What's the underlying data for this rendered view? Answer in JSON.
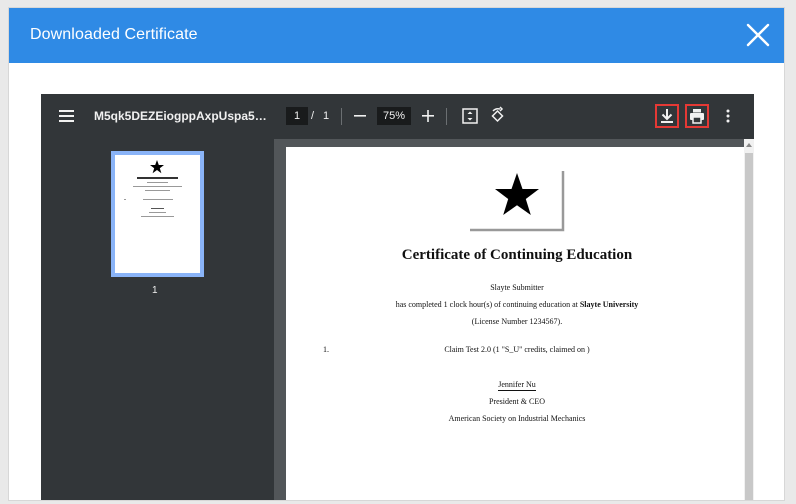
{
  "modal": {
    "title": "Downloaded Certificate"
  },
  "viewer": {
    "filename": "M5qk5DEZEiogppAxpUspa5LcJfO...",
    "current_page": "1",
    "page_separator": "/",
    "total_pages": "1",
    "zoom": "75%",
    "thumbnail_page_number": "1"
  },
  "certificate": {
    "title": "Certificate of Continuing Education",
    "recipient": "Slayte Submitter",
    "completion_prefix": "has completed ",
    "hours": "1",
    "completion_middle": " clock hour(s) of continuing education at ",
    "university": "Slayte University",
    "license": "(License Number 1234567).",
    "item_number": "1.",
    "item_text": "Claim Test 2.0 (1 \"S_U\" credits, claimed on )",
    "signer_name": "Jennifer Nu",
    "signer_title": "President & CEO",
    "organization": "American Society on Industrial Mechanics"
  },
  "colors": {
    "header_blue": "#2f8ae5",
    "toolbar": "#323639",
    "viewer_bg": "#525659",
    "highlight_red": "#e53935",
    "thumb_border": "#8ab4f8"
  }
}
